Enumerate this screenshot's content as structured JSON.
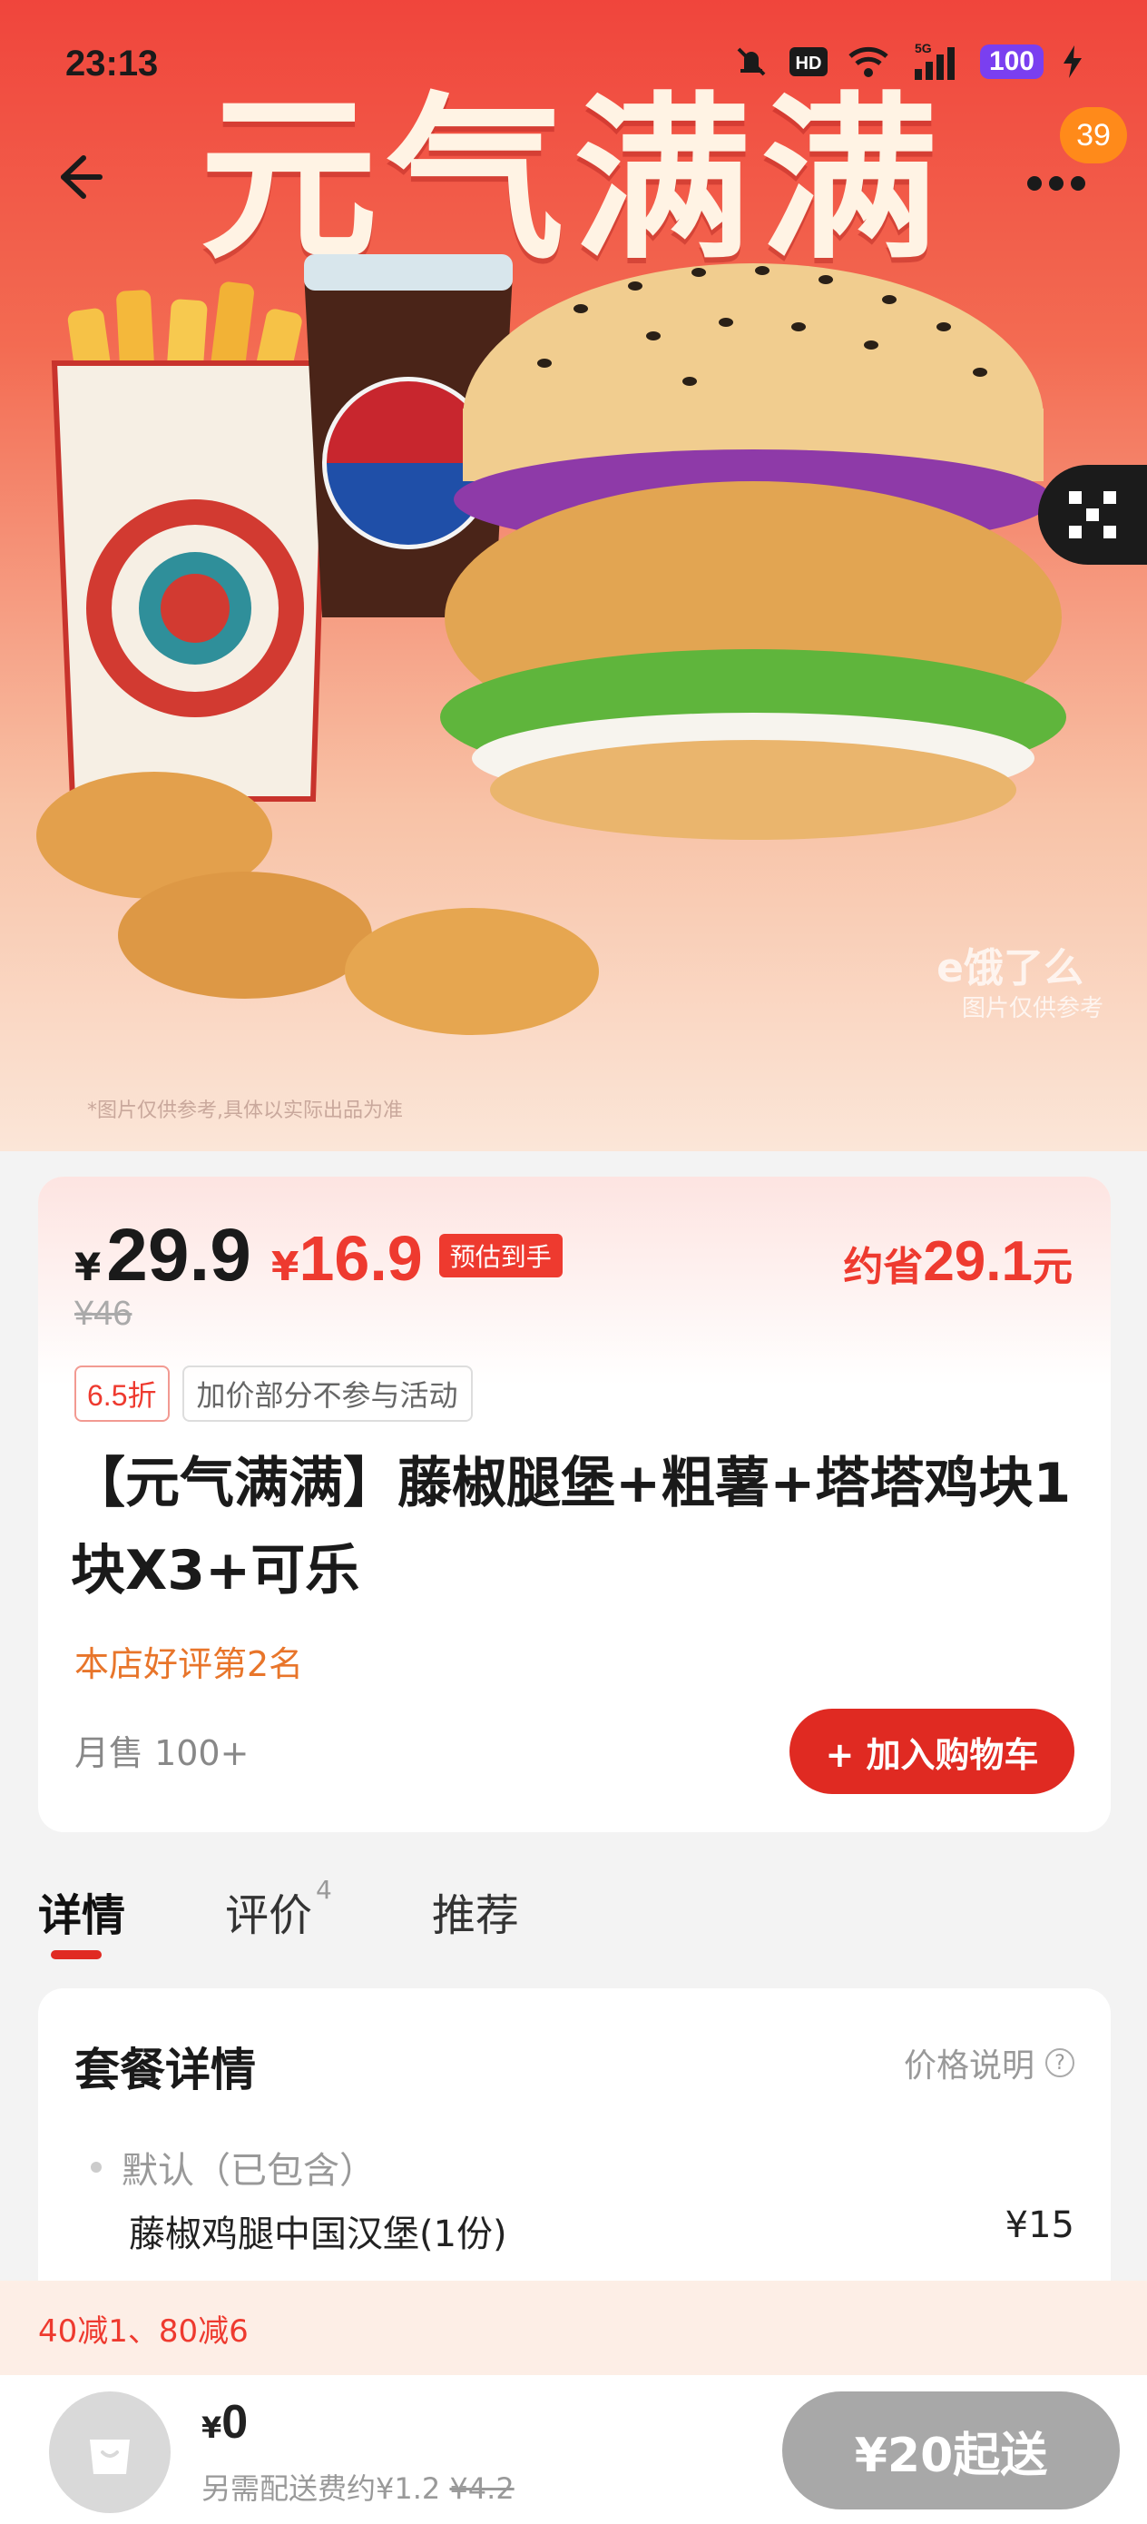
{
  "status_bar": {
    "time": "23:13",
    "network": "5G",
    "battery": "100"
  },
  "hero": {
    "title": "元气满满",
    "cart_badge": "39",
    "watermark": "e饿了么",
    "watermark_sub": "图片仅供参考",
    "disclaimer": "*图片仅供参考,具体以实际出品为准",
    "icons": {
      "back": "back-arrow-icon",
      "more": "more-icon",
      "qr": "qr-code-icon"
    }
  },
  "product": {
    "price_symbol": "¥",
    "price": "29.9",
    "deal_price_symbol": "¥",
    "deal_price": "16.9",
    "estimate_label": "预估到手",
    "save_prefix": "约省",
    "save_amount": "29.1",
    "save_suffix": "元",
    "original_price": "¥46",
    "discount_tag": "6.5折",
    "note_tag": "加价部分不参与活动",
    "title": "【元气满满】藤椒腿堡+粗薯+塔塔鸡块1块X3+可乐",
    "rank": "本店好评第2名",
    "monthly_sales": "月售 100+",
    "add_to_cart": "+ 加入购物车"
  },
  "tabs": [
    {
      "label": "详情",
      "active": true
    },
    {
      "label": "评价",
      "count": "4"
    },
    {
      "label": "推荐"
    }
  ],
  "details": {
    "title": "套餐详情",
    "price_note": "价格说明",
    "group_label": "默认（已包含）",
    "items": [
      {
        "name": "藤椒鸡腿中国汉堡(1份)",
        "price": "¥15"
      }
    ]
  },
  "promo": {
    "text": "40减1、80减6"
  },
  "bottom_bar": {
    "cart_symbol": "¥",
    "cart_total": "0",
    "delivery_prefix": "另需配送费约¥1.2",
    "delivery_original": "¥4.2",
    "min_order": "¥20起送"
  },
  "colors": {
    "accent_red": "#e02a22",
    "price_red": "#ee3a2f",
    "rank_orange": "#e8752a",
    "badge_orange": "#ff8a1a",
    "battery_purple": "#7a3ff0",
    "disabled_gray": "#a8a8a8"
  }
}
